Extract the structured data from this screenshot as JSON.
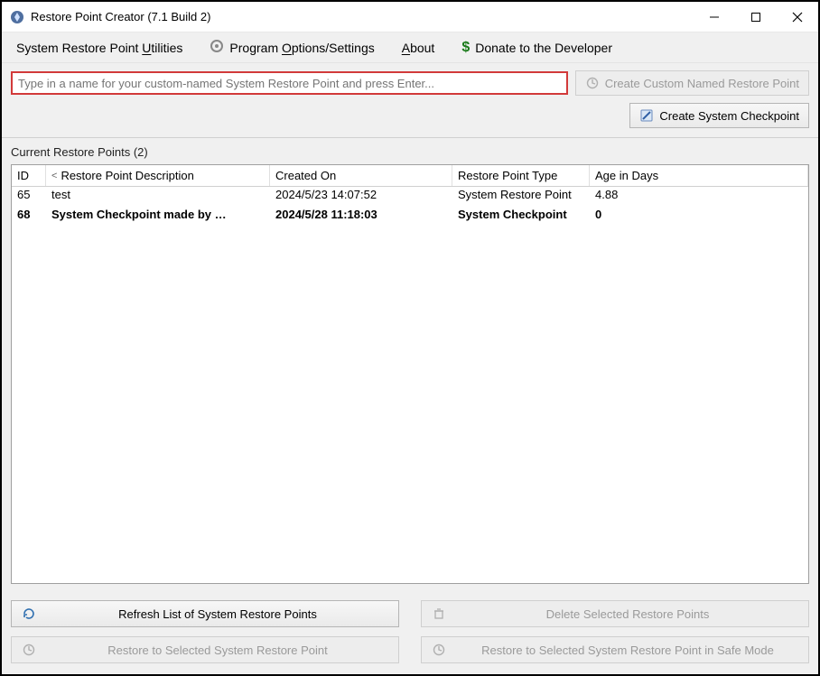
{
  "window": {
    "title": "Restore Point Creator (7.1 Build 2)"
  },
  "menu": {
    "utilities_pre": "System Restore Point ",
    "utilities_u": "U",
    "utilities_post": "tilities",
    "options_pre": "Program ",
    "options_u": "O",
    "options_post": "ptions/Settings",
    "about_pre": "",
    "about_u": "A",
    "about_post": "bout",
    "donate": "Donate to the Developer"
  },
  "toolbar": {
    "name_placeholder": "Type in a name for your custom-named System Restore Point and press Enter...",
    "create_custom": "Create Custom Named Restore Point",
    "create_checkpoint": "Create System Checkpoint"
  },
  "section": {
    "label": "Current Restore Points (2)"
  },
  "grid": {
    "headers": {
      "id": "ID",
      "desc": "Restore Point Description",
      "created": "Created On",
      "type": "Restore Point Type",
      "age": "Age in Days"
    },
    "rows": [
      {
        "id": "65",
        "desc": "test",
        "created": "2024/5/23 14:07:52",
        "type": "System Restore Point",
        "age": "4.88",
        "bold": false
      },
      {
        "id": "68",
        "desc": "System Checkpoint made by …",
        "created": "2024/5/28 11:18:03",
        "type": "System Checkpoint",
        "age": "0",
        "bold": true
      }
    ]
  },
  "footer": {
    "refresh": "Refresh List of System Restore Points",
    "delete": "Delete Selected Restore Points",
    "restore": "Restore to Selected System Restore Point",
    "restore_safe": "Restore to Selected System Restore Point in Safe Mode"
  }
}
